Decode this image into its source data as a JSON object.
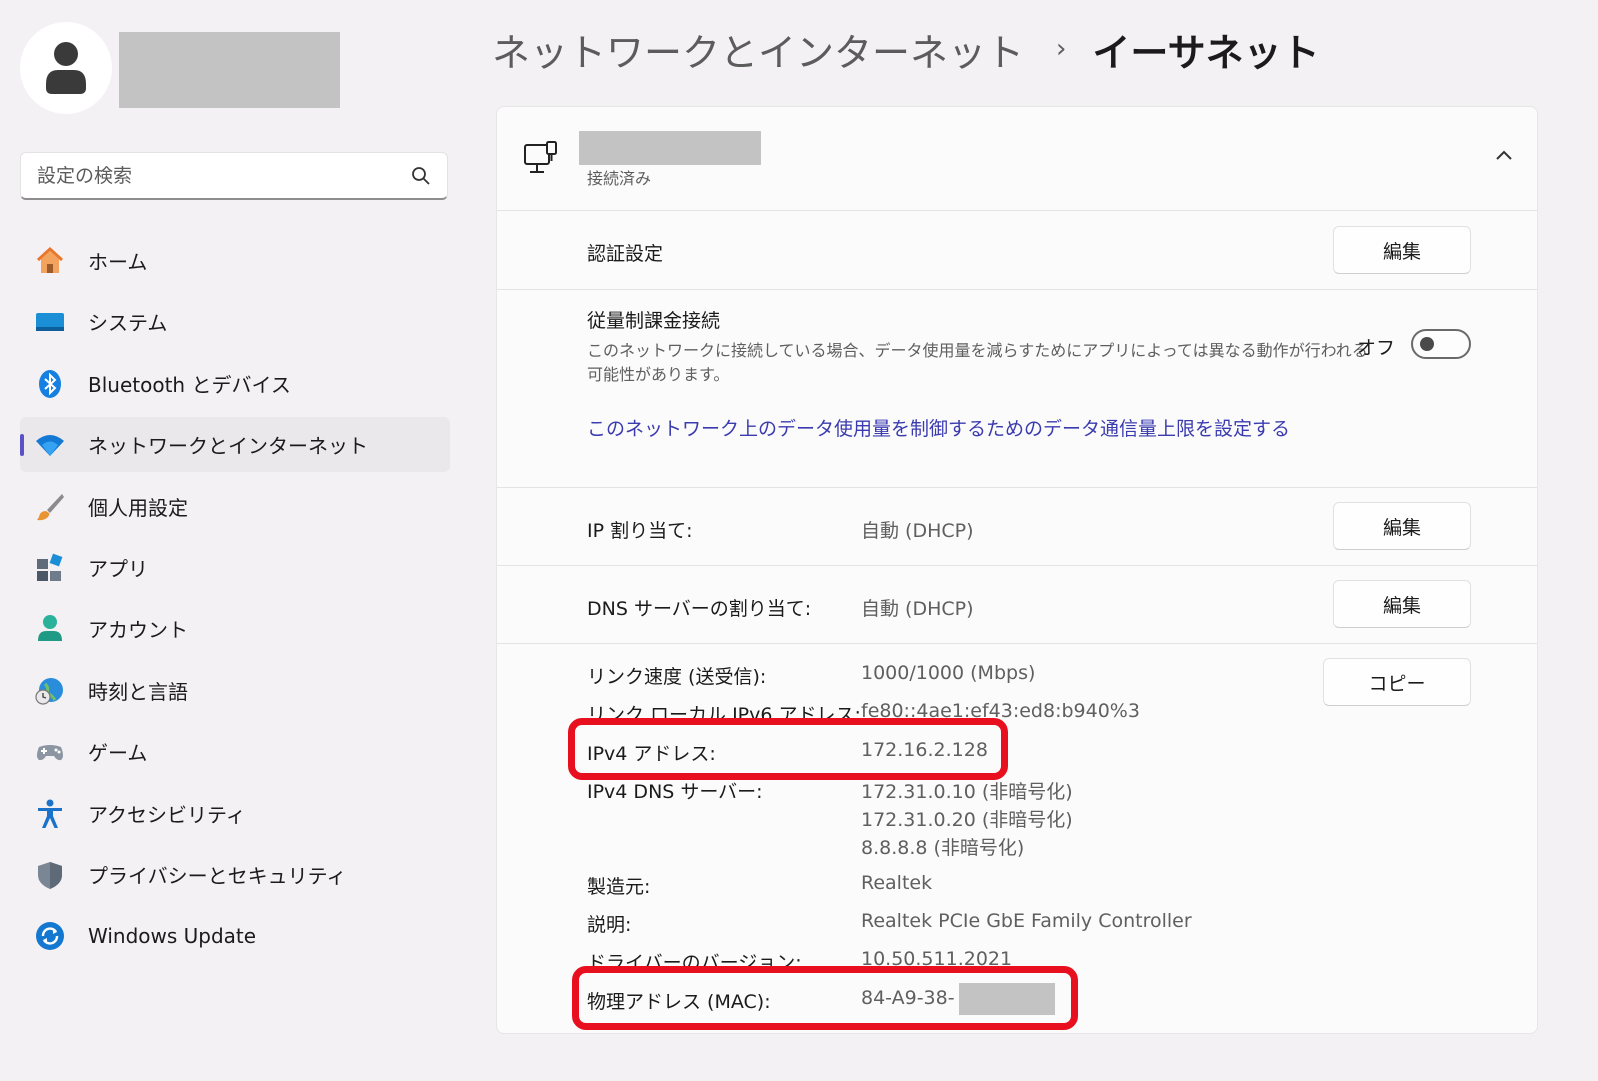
{
  "sidebar": {
    "search_placeholder": "設定の検索",
    "items": [
      {
        "label": "ホーム",
        "icon": "home-icon"
      },
      {
        "label": "システム",
        "icon": "system-icon"
      },
      {
        "label": "Bluetooth とデバイス",
        "icon": "bluetooth-icon"
      },
      {
        "label": "ネットワークとインターネット",
        "icon": "wifi-icon",
        "active": true
      },
      {
        "label": "個人用設定",
        "icon": "brush-icon"
      },
      {
        "label": "アプリ",
        "icon": "apps-icon"
      },
      {
        "label": "アカウント",
        "icon": "account-icon"
      },
      {
        "label": "時刻と言語",
        "icon": "time-language-icon"
      },
      {
        "label": "ゲーム",
        "icon": "gamepad-icon"
      },
      {
        "label": "アクセシビリティ",
        "icon": "accessibility-icon"
      },
      {
        "label": "プライバシーとセキュリティ",
        "icon": "shield-icon"
      },
      {
        "label": "Windows Update",
        "icon": "update-icon"
      }
    ]
  },
  "header": {
    "parent": "ネットワークとインターネット",
    "separator": "›",
    "current": "イーサネット"
  },
  "card": {
    "status": "接続済み",
    "auth": {
      "label": "認証設定",
      "button": "編集"
    },
    "metered": {
      "label": "従量制課金接続",
      "description_line1": "このネットワークに接続している場合、データ使用量を減らすためにアプリによっては異なる動作が行われる",
      "description_line2": "可能性があります。",
      "state": "オフ",
      "link": "このネットワーク上のデータ使用量を制御するためのデータ通信量上限を設定する"
    },
    "ip_assign": {
      "label": "IP 割り当て:",
      "value": "自動 (DHCP)",
      "button": "編集"
    },
    "dns_assign": {
      "label": "DNS サーバーの割り当て:",
      "value": "自動 (DHCP)",
      "button": "編集"
    },
    "copy_button": "コピー",
    "properties": {
      "link_speed": {
        "label": "リンク速度 (送受信):",
        "value": "1000/1000 (Mbps)"
      },
      "ipv6": {
        "label": "リンク ローカル IPv6 アドレス:",
        "value": "fe80::4ae1:ef43:ed8:b940%3"
      },
      "ipv4": {
        "label": "IPv4 アドレス:",
        "value": "172.16.2.128"
      },
      "ipv4_dns": {
        "label": "IPv4 DNS サーバー:",
        "values": [
          "172.31.0.10 (非暗号化)",
          "172.31.0.20 (非暗号化)",
          "8.8.8.8 (非暗号化)"
        ]
      },
      "manufacturer": {
        "label": "製造元:",
        "value": "Realtek"
      },
      "description": {
        "label": "説明:",
        "value": "Realtek PCIe GbE Family Controller"
      },
      "driver": {
        "label": "ドライバーのバージョン:",
        "value": "10.50.511.2021"
      },
      "mac": {
        "label": "物理アドレス (MAC):",
        "value": "84-A9-38-"
      }
    }
  },
  "colors": {
    "highlight": "#e8101e",
    "accent": "#5b51c7",
    "link": "#3b3bb0"
  }
}
